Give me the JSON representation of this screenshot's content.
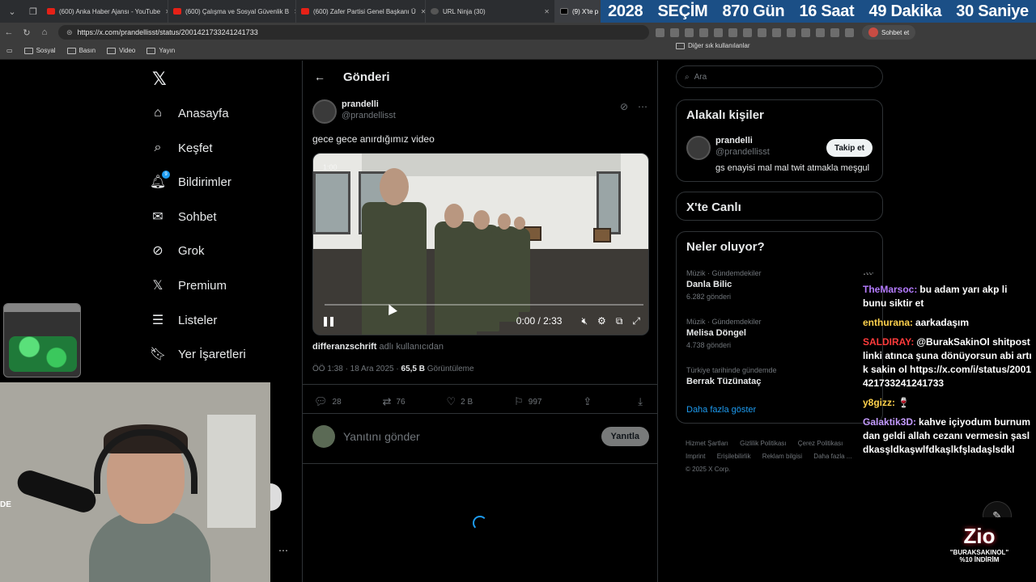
{
  "browser": {
    "tabs": [
      {
        "label": "(600) Anka Haber Ajansı - YouTube",
        "icon": "youtube-icon"
      },
      {
        "label": "(600) Çalışma ve Sosyal Güvenlik B",
        "icon": "youtube-icon"
      },
      {
        "label": "(600) Zafer Partisi Genel Başkanı Ü",
        "icon": "youtube-icon"
      },
      {
        "label": "URL Ninja (30)",
        "icon": "ninja-icon"
      },
      {
        "label": "(9) X'te p",
        "icon": "x-icon"
      }
    ],
    "url": "https://x.com/prandellisst/status/2001421733241241733",
    "profile_button": "Sohbet et",
    "bookmarks": [
      "Sosyal",
      "Basın",
      "Video",
      "Yayın"
    ],
    "other_bookmarks": "Diğer sık kullanılanlar"
  },
  "countdown": {
    "year": "2028",
    "label": "SEÇİM",
    "days": "870 Gün",
    "hours": "16 Saat",
    "minutes": "49 Dakika",
    "seconds": "30 Saniye"
  },
  "nav": {
    "items": [
      {
        "label": "Anasayfa",
        "icon": "home-icon"
      },
      {
        "label": "Keşfet",
        "icon": "search-icon"
      },
      {
        "label": "Bildirimler",
        "icon": "bell-icon",
        "badge": "9"
      },
      {
        "label": "Sohbet",
        "icon": "mail-icon"
      },
      {
        "label": "Grok",
        "icon": "grok-icon"
      },
      {
        "label": "Premium",
        "icon": "x-premium-icon"
      },
      {
        "label": "Listeler",
        "icon": "list-icon"
      },
      {
        "label": "Yer İşaretleri",
        "icon": "bookmark-icon"
      }
    ]
  },
  "post": {
    "header_title": "Gönderi",
    "author_name": "prandelli",
    "author_handle": "@prandellisst",
    "text": "gece gece anırdığımız video",
    "video": {
      "badge": "1:00",
      "time": "0:00 / 2:33",
      "progress": 0.0
    },
    "attribution_user": "differanzschrift",
    "attribution_suffix": " adlı kullanıcıdan",
    "time": "ÖÖ 1:38 · 18 Ara 2025 · ",
    "views": "65,5 B",
    "views_label": " Görüntüleme",
    "stats": {
      "replies": "28",
      "reposts": "76",
      "likes": "2 B",
      "bookmarks": "997"
    },
    "reply_placeholder": "Yanıtını gönder",
    "reply_button": "Yanıtla"
  },
  "sidebar": {
    "search_placeholder": "Ara",
    "related_title": "Alakalı kişiler",
    "related_name": "prandelli",
    "related_handle": "@prandellisst",
    "related_bio": "gs enayisi mal mal twit atmakla meşgul",
    "follow_label": "Takip et",
    "live_title": "X'te Canlı",
    "trends_title": "Neler oluyor?",
    "trends": [
      {
        "category": "Müzik · Gündemdekiler",
        "name": "Danla Bilic",
        "count": "6.282 gönderi"
      },
      {
        "category": "Müzik · Gündemdekiler",
        "name": "Melisa Döngel",
        "count": "4.738 gönderi"
      },
      {
        "category": "Türkiye tarihinde gündemde",
        "name": "Berrak Tüzünataç",
        "count": ""
      }
    ],
    "show_more": "Daha fazla göster",
    "footer_links": [
      "Hizmet Şartları",
      "Gizlilik Politikası",
      "Çerez Politikası",
      "Imprint",
      "Erişilebilirlik",
      "Reklam bilgisi",
      "Daha fazla ..."
    ],
    "copyright": "© 2025 X Corp."
  },
  "chat": [
    {
      "user": "TheMarsoc:",
      "color": "#b57cff",
      "text": "bu adam yarı akp li bunu siktir et"
    },
    {
      "user": "enthurana:",
      "color": "#ffd24d",
      "text": "aarkadaşım"
    },
    {
      "user": "SALDIRAY:",
      "color": "#ff3b3b",
      "text": "@BurakSakinOl shitpost linki atınca şuna dönüyorsun abi artık sakin ol https://x.com/i/status/2001421733241241733"
    },
    {
      "user": "y8gizz:",
      "color": "#ffd24d",
      "text": "🍷"
    },
    {
      "user": "Galaktik3D:",
      "color": "#c49bff",
      "text": "kahve içiyodum burnumdan geldi allah cezanı vermesin şasldkasşldkaşwlfdkaşlkfşladaşlsdkl"
    }
  ],
  "overlay": {
    "webcam_label": "DE",
    "sponsor_logo": "Zio",
    "sponsor_line1": "\"BURAKSAKINOL\"",
    "sponsor_line2": "%10 İNDİRİM"
  }
}
